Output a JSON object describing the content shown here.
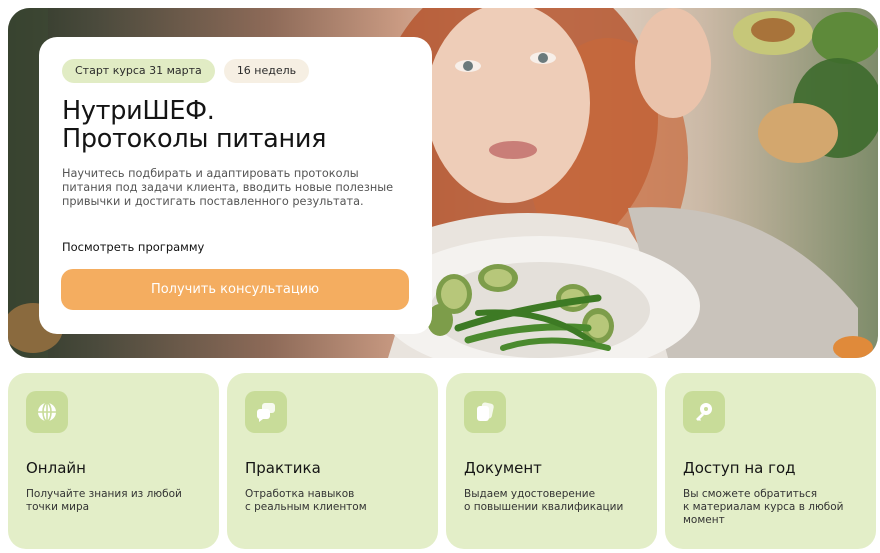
{
  "hero": {
    "badge_start": "Старт курса 31 марта",
    "badge_weeks": "16 недель",
    "title_line1": "НутриШЕФ.",
    "title_line2": "Протоколы питания",
    "subtitle": "Научитесь подбирать и адаптировать протоколы питания под задачи клиента, вводить новые полезные привычки и достигать поставленного результата.",
    "program_link": "Посмотреть программу",
    "cta_label": "Получить консультацию",
    "photo_icon": "woman-with-vegetable-plate-photo"
  },
  "features": [
    {
      "icon": "globe-icon",
      "title": "Онлайн",
      "text_lines": [
        "Получайте знания из любой",
        "точки мира"
      ]
    },
    {
      "icon": "chat-bubbles-icon",
      "title": "Практика",
      "text_lines": [
        "Отработка навыков",
        "с реальным клиентом"
      ]
    },
    {
      "icon": "document-icon",
      "title": "Документ",
      "text_lines": [
        "Выдаем удостоверение",
        "о повышении квалификации"
      ]
    },
    {
      "icon": "key-icon",
      "title": "Доступ на год",
      "text_lines": [
        "Вы сможете обратиться",
        "к материалам курса в любой",
        "момент"
      ]
    }
  ],
  "colors": {
    "accent_button": "#f4ad60",
    "feature_background": "#e3eec8",
    "badge_green": "#e1ecc4",
    "badge_beige": "#f6efe3"
  }
}
